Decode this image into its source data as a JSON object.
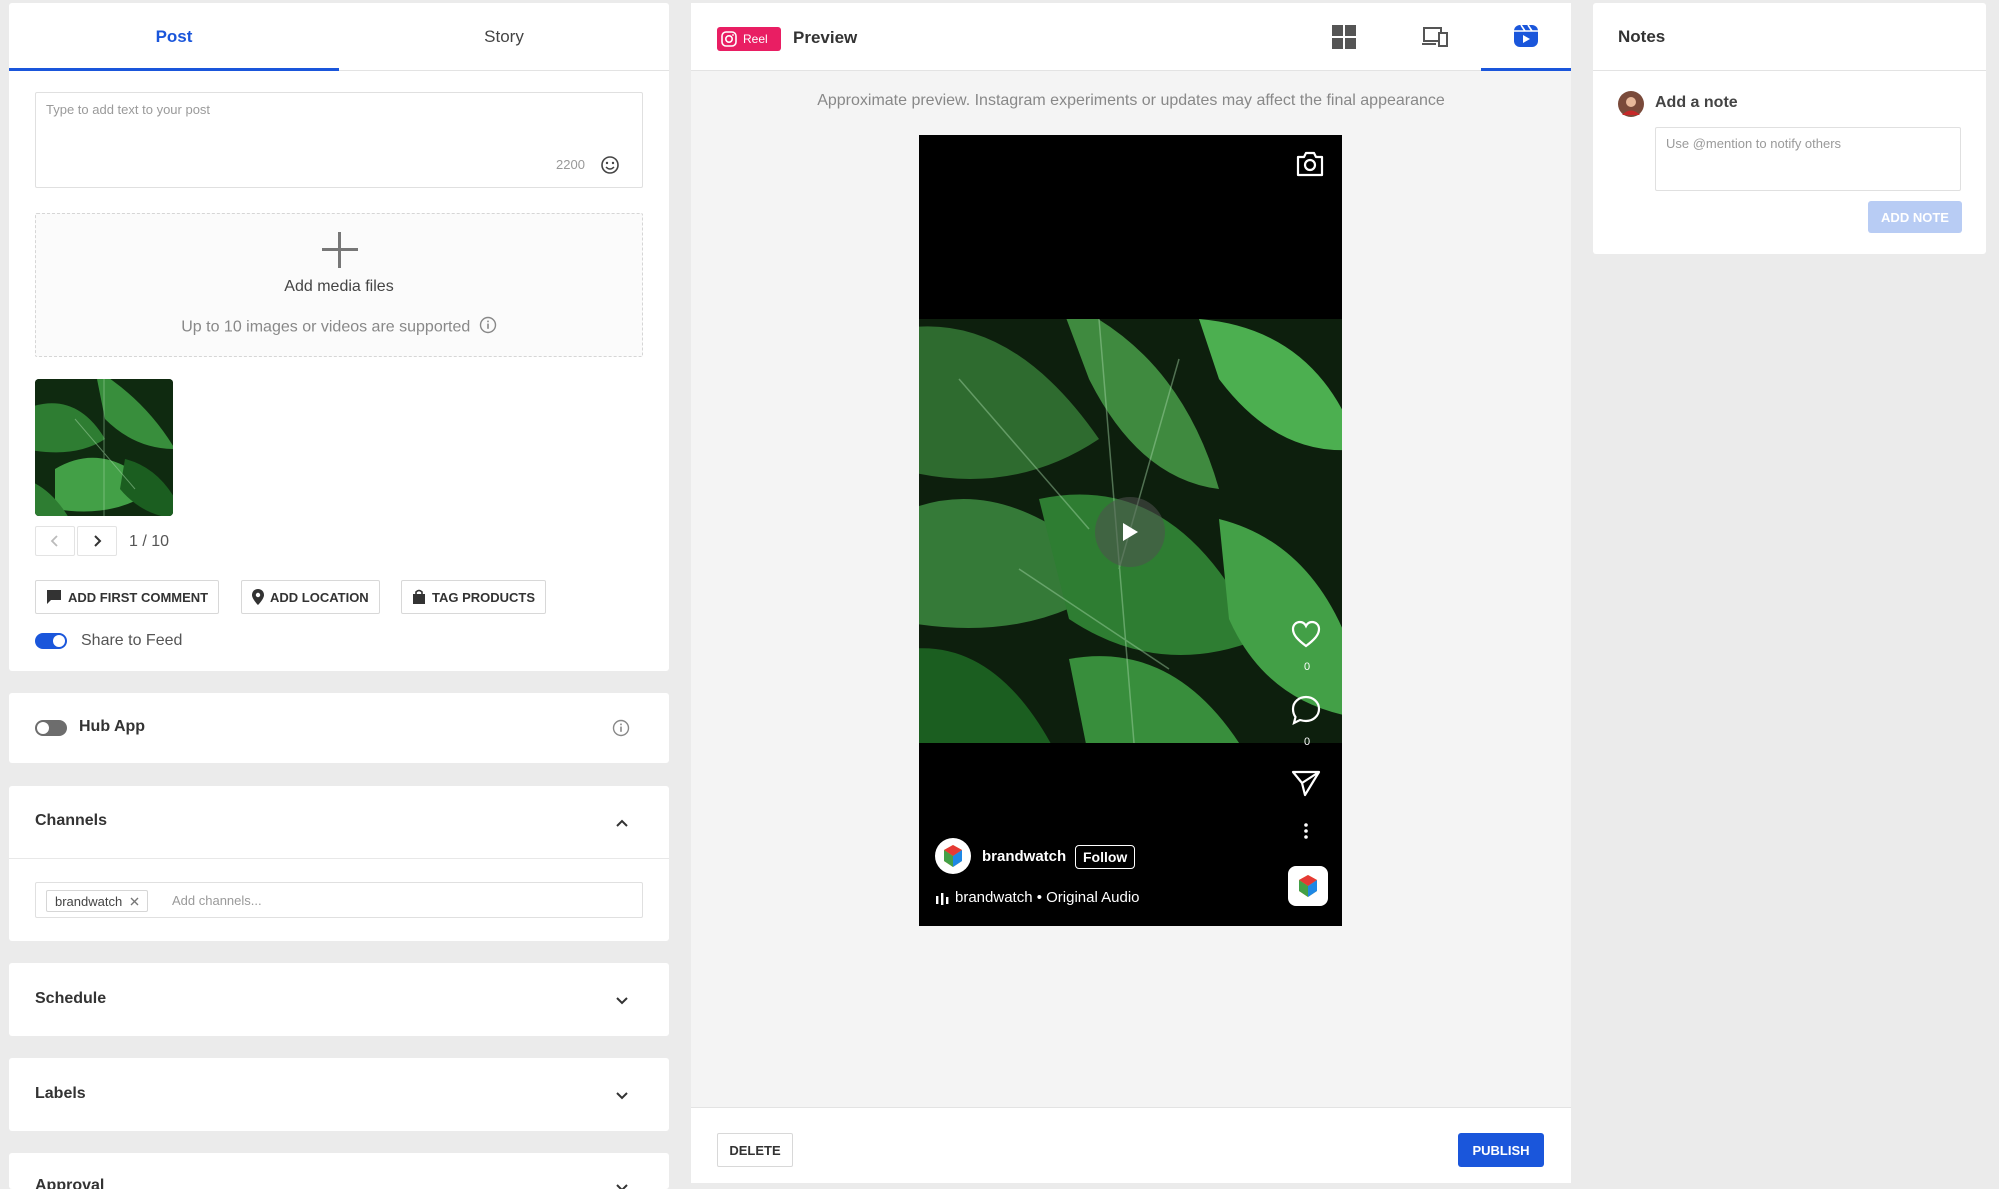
{
  "composer": {
    "tabs": [
      {
        "label": "Post"
      },
      {
        "label": "Story"
      }
    ],
    "text": {
      "placeholder": "Type to add text to your post",
      "char_count": "2200"
    },
    "media": {
      "add_label": "Add media files",
      "hint": "Up to 10 images or videos are supported"
    },
    "pager": {
      "text": "1 / 10"
    },
    "actions": {
      "first_comment": "ADD FIRST COMMENT",
      "location": "ADD LOCATION",
      "tag_products": "TAG PRODUCTS"
    },
    "share_to_feed": {
      "label": "Share to Feed",
      "on": true
    }
  },
  "hub_app": {
    "label": "Hub App",
    "on": false
  },
  "channels": {
    "title": "Channels",
    "chip": "brandwatch",
    "placeholder": "Add channels..."
  },
  "schedule": {
    "title": "Schedule"
  },
  "labels": {
    "title": "Labels"
  },
  "approval": {
    "title": "Approval"
  },
  "preview": {
    "badge": "Reel",
    "title": "Preview",
    "notice": "Approximate preview. Instagram experiments or updates may affect the final appearance",
    "likes": "0",
    "comments": "0",
    "account": "brandwatch",
    "follow": "Follow",
    "audio": "brandwatch • Original Audio",
    "delete": "DELETE",
    "publish": "PUBLISH"
  },
  "notes": {
    "title": "Notes",
    "add_label": "Add a note",
    "placeholder": "Use @mention to notify others",
    "button": "ADD NOTE"
  },
  "colors": {
    "accent": "#1a56db",
    "reel": "#e91e63"
  }
}
